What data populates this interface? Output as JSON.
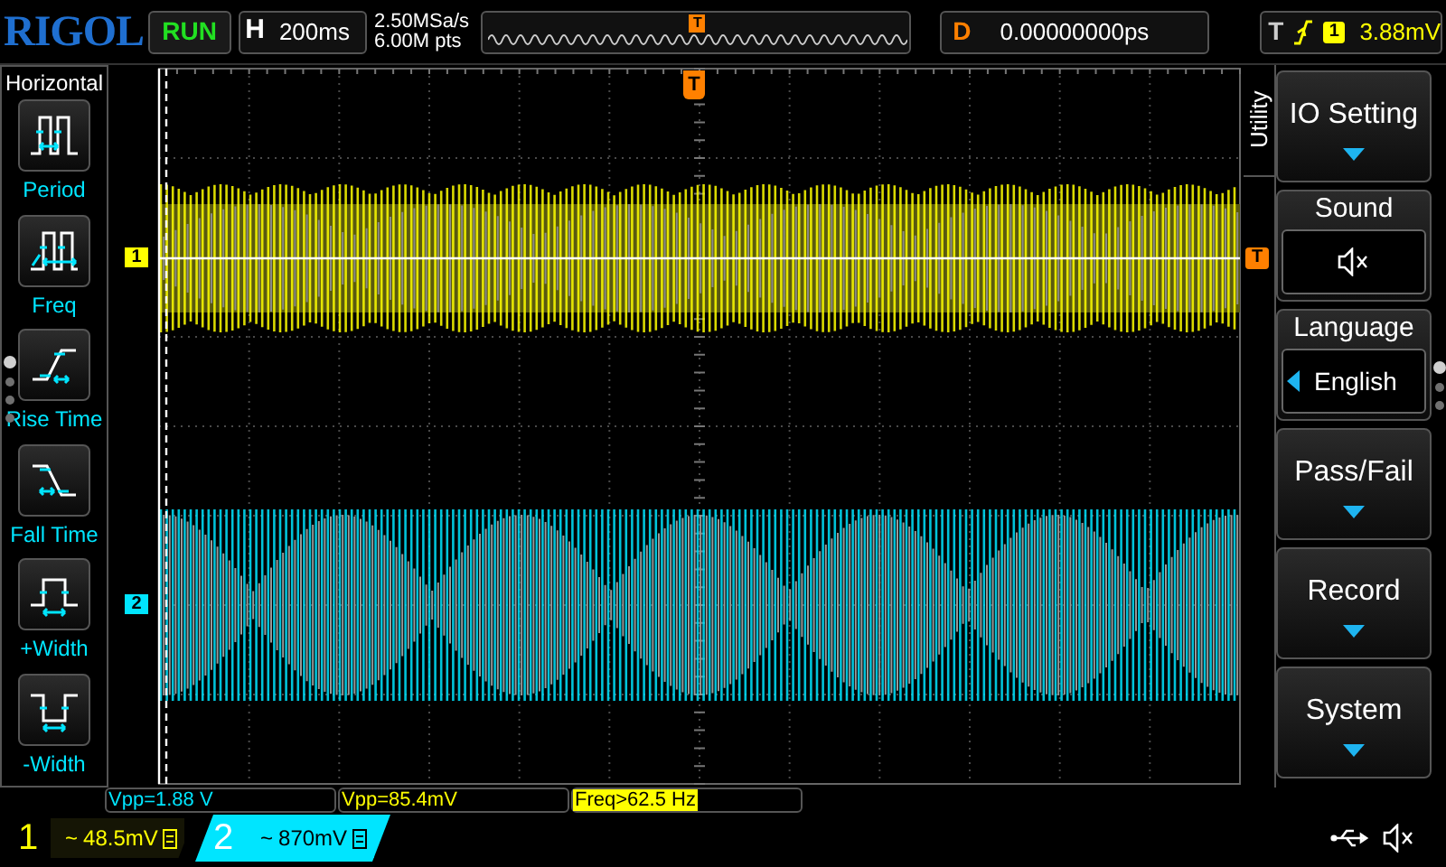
{
  "brand": "RIGOL",
  "run_state": "RUN",
  "horizontal": {
    "label": "H",
    "timebase": "200ms"
  },
  "acquisition": {
    "sample_rate": "2.50MSa/s",
    "memory_depth": "6.00M pts"
  },
  "overview": {
    "trigger_marker": "T"
  },
  "delay": {
    "label": "D",
    "value": "0.00000000ps"
  },
  "trigger": {
    "label": "T",
    "source": "1",
    "level": "3.88mV"
  },
  "left_menu": {
    "title": "Horizontal",
    "items": [
      {
        "kind": "period",
        "label": "Period"
      },
      {
        "kind": "freq",
        "label": "Freq"
      },
      {
        "kind": "rise",
        "label": "Rise Time"
      },
      {
        "kind": "fall",
        "label": "Fall Time"
      },
      {
        "kind": "pos_width",
        "label": "+Width"
      },
      {
        "kind": "neg_width",
        "label": "-Width"
      }
    ],
    "pages": [
      {
        "selected": true
      },
      {
        "selected": false
      },
      {
        "selected": false
      },
      {
        "selected": false
      }
    ]
  },
  "display": {
    "top_trigger_marker": "T",
    "right_trigger_marker": "T",
    "channel_markers": [
      {
        "label": "1",
        "color": "#ffff00"
      },
      {
        "label": "2",
        "color": "#00e5ff"
      }
    ]
  },
  "right_menu": {
    "tab": "Utility",
    "items": [
      {
        "kind": "submenu",
        "label": "IO Setting"
      },
      {
        "kind": "sound",
        "label": "Sound",
        "muted": true
      },
      {
        "kind": "value",
        "label": "Language",
        "value": "English"
      },
      {
        "kind": "submenu",
        "label": "Pass/Fail"
      },
      {
        "kind": "submenu",
        "label": "Record"
      },
      {
        "kind": "submenu",
        "label": "System"
      }
    ],
    "pages": [
      {
        "selected": true
      },
      {
        "selected": false
      },
      {
        "selected": false
      }
    ]
  },
  "measurements": [
    {
      "kind": "ch2",
      "text": "Vpp=1.88 V",
      "highlighted": false
    },
    {
      "kind": "ch1",
      "text": "Vpp=85.4mV",
      "highlighted": false
    },
    {
      "kind": "ch1",
      "text": "Freq>62.5 Hz",
      "highlighted": true
    }
  ],
  "channels": [
    {
      "number": "1",
      "coupling": "~",
      "scale": "48.5mV",
      "color": "#ffff00",
      "selected": false
    },
    {
      "number": "2",
      "coupling": "~",
      "scale": "870mV",
      "color": "#00e5ff",
      "selected": true
    }
  ]
}
